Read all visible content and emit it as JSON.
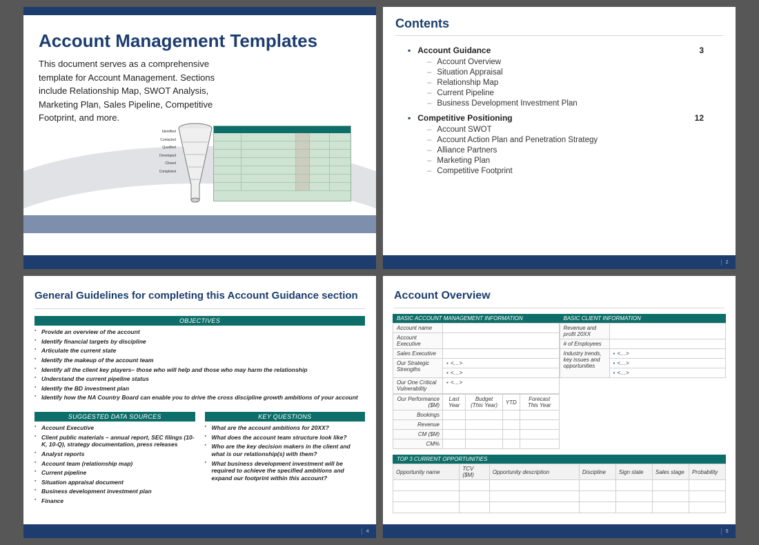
{
  "slide1": {
    "title": "Account Management Templates",
    "intro": "This document serves as a comprehensive template for Account Management.  Sections include Relationship Map, SWOT Analysis, Marketing Plan, Sales Pipeline, Competitive Footprint, and more.",
    "funnel_labels": [
      "Identified",
      "Contacted",
      "Qualified",
      "Developed",
      "Closed",
      "Completed"
    ]
  },
  "slide2": {
    "title": "Contents",
    "sections": [
      {
        "name": "Account Guidance",
        "page": "3",
        "subs": [
          "Account Overview",
          "Situation Appraisal",
          "Relationship Map",
          "Current Pipeline",
          "Business Development Investment Plan"
        ]
      },
      {
        "name": "Competitive Positioning",
        "page": "12",
        "subs": [
          "Account SWOT",
          "Account Action Plan and Penetration Strategy",
          "Alliance Partners",
          "Marketing Plan",
          "Competitive Footprint"
        ]
      }
    ],
    "page_number": "2"
  },
  "slide3": {
    "title": "General Guidelines for completing this Account Guidance section",
    "objectives_header": "OBJECTIVES",
    "objectives": [
      "Provide an overview of the account",
      "Identify financial targets by discipline",
      "Articulate the current state",
      "Identify the makeup of the account team",
      "Identify all the client key players– those who will help and those who may harm the relationship",
      "Understand the current pipeline status",
      "Identify the BD investment plan",
      "Identify how the NA Country Board can enable you to drive the cross discipline growth ambitions of your account"
    ],
    "sources_header": "SUGGESTED DATA SOURCES",
    "sources": [
      "Account Executive",
      "Client public materials – annual report, SEC filings (10-K, 10-Q), strategy documentation, press releases",
      "Analyst reports",
      "Account team (relationship map)",
      "Current pipeline",
      "Situation appraisal document",
      "Business development investment plan",
      "Finance"
    ],
    "questions_header": "KEY QUESTIONS",
    "questions": [
      "What are the account ambitions for 20XX?",
      "What does the account team structure look like?",
      "Who are the key decision makers in the client and what is our relationship(s) with them?",
      "What business development investment will be required to achieve the specified ambitions and expand our footprint within this account?"
    ],
    "page_number": "4"
  },
  "slide4": {
    "title": "Account Overview",
    "left_header": "BASIC ACCOUNT MANAGEMENT INFORMATION",
    "right_header": "BASIC CLIENT INFORMATION",
    "left_rows": {
      "account_name": "Account name",
      "account_exec": "Account Executive",
      "sales_exec": "Sales Executive",
      "strengths": "Our Strategic Strengths",
      "strength_a": "<…>",
      "strength_b": "<…>",
      "vuln": "Our One Critical Vulnerability",
      "vuln_a": "<…>"
    },
    "right_rows": {
      "rev_profit": "Revenue and profit 20XX",
      "employees": "# of Employees",
      "trends": "Industry trends, key issues and opportunities",
      "trend_a": "<…>",
      "trend_b": "<…>",
      "trend_c": "<…>"
    },
    "perf": {
      "label": "Our Performance ($M)",
      "cols": [
        "Last Year",
        "Budget (This Year)",
        "YTD",
        "Forecast This Year"
      ],
      "rows": [
        "Bookings",
        "Revenue",
        "CM ($M)",
        "CM%"
      ]
    },
    "opps": {
      "header": "TOP 3 CURRENT OPPORTUNITIES",
      "cols": [
        "Opportunity name",
        "TCV ($M)",
        "Opportunity description",
        "Discipline",
        "Sign state",
        "Sales stage",
        "Probability"
      ]
    },
    "page_number": "5"
  }
}
